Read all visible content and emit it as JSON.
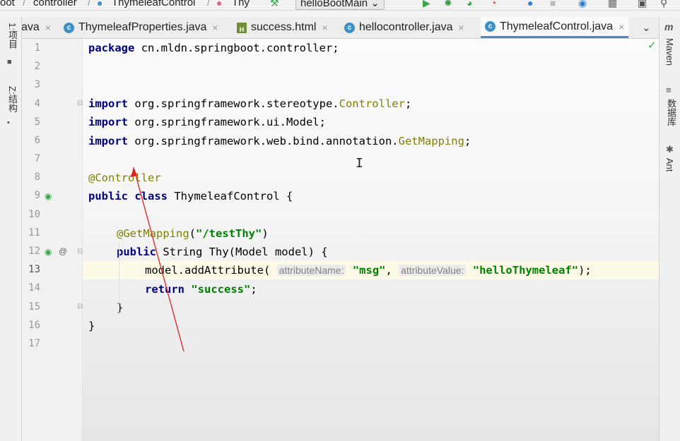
{
  "breadcrumb": {
    "items": [
      "oot",
      "controller",
      "ThymeleafControl",
      "Thy"
    ],
    "run_config": "helloBootMain"
  },
  "tabs": [
    {
      "label": "ava",
      "type": "java",
      "active": false
    },
    {
      "label": "ThymeleafProperties.java",
      "type": "java",
      "active": false
    },
    {
      "label": "success.html",
      "type": "html",
      "active": false
    },
    {
      "label": "hellocontroller.java",
      "type": "java",
      "active": false
    },
    {
      "label": "ThymeleafControl.java",
      "type": "java",
      "active": true
    }
  ],
  "left_tools": [
    "1:项目",
    "Z:结构"
  ],
  "right_tools": [
    "Maven",
    "数据库",
    "Ant"
  ],
  "line_numbers": [
    "1",
    "2",
    "3",
    "4",
    "5",
    "6",
    "7",
    "8",
    "9",
    "10",
    "11",
    "12",
    "13",
    "14",
    "15",
    "16",
    "17"
  ],
  "code": {
    "l1": {
      "kw": "package",
      "rest": " cn.mldn.springboot.controller;"
    },
    "l4": {
      "kw": "import",
      "rest": " org.springframework.stereotype.",
      "cls": "Controller",
      "end": ";"
    },
    "l5": {
      "kw": "import",
      "rest": " org.springframework.ui.Model;"
    },
    "l6": {
      "kw": "import",
      "rest": " org.springframework.web.bind.annotation.",
      "cls": "GetMapping",
      "end": ";"
    },
    "l8": {
      "ann": "@Controller"
    },
    "l9": {
      "kw1": "public",
      "kw2": "class",
      "rest": " ThymeleafControl {"
    },
    "l11": {
      "ann": "@GetMapping",
      "open": "(",
      "str": "\"/testThy\"",
      "close": ")"
    },
    "l12": {
      "kw": "public",
      "rest": " String Thy(Model model) {"
    },
    "l13": {
      "pre": "model.addAttribute(",
      "hint1": "attributeName:",
      "str1": "\"msg\"",
      "comma": ", ",
      "hint2": "attributeValue:",
      "str2": "\"helloThymeleaf\"",
      "end": ");"
    },
    "l14": {
      "kw": "return",
      "str": "\"success\"",
      "end": ";"
    },
    "l15": {
      "text": "}"
    },
    "l16": {
      "text": "}"
    }
  },
  "colors": {
    "keyword": "#000080",
    "annotation": "#808000",
    "string": "#008000",
    "current_line": "#fcfae6",
    "arrow": "#e02020"
  }
}
